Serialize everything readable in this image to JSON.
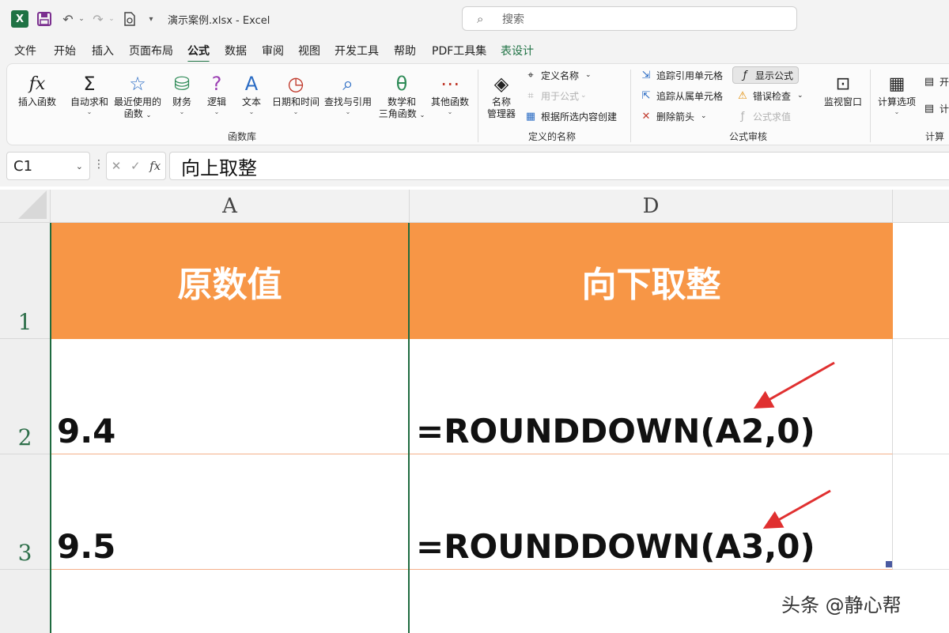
{
  "titlebar": {
    "excel_logo": "X",
    "filename": "演示案例.xlsx",
    "separator": "-",
    "app": "Excel",
    "search_placeholder": "搜索"
  },
  "menu": [
    "文件",
    "开始",
    "插入",
    "页面布局",
    "公式",
    "数据",
    "审阅",
    "视图",
    "开发工具",
    "帮助",
    "PDF工具集",
    "表设计"
  ],
  "menu_active": "公式",
  "ribbon": {
    "function_library": {
      "label": "函数库",
      "buttons": {
        "insert": "插入函数",
        "autosum": "自动求和",
        "recent_line1": "最近使用的",
        "recent_line2": "函数",
        "finance": "财务",
        "logic": "逻辑",
        "text": "文本",
        "datetime": "日期和时间",
        "lookup": "查找与引用",
        "math_line1": "数学和",
        "math_line2": "三角函数",
        "other": "其他函数"
      }
    },
    "defined_names": {
      "label": "定义的名称",
      "manager_line1": "名称",
      "manager_line2": "管理器",
      "define": "定义名称",
      "use": "用于公式",
      "create": "根据所选内容创建"
    },
    "auditing": {
      "label": "公式审核",
      "trace_prec": "追踪引用单元格",
      "trace_dep": "追踪从属单元格",
      "remove_arrows": "删除箭头",
      "show_formulas": "显示公式",
      "error_check": "错误检查",
      "evaluate": "公式求值",
      "watch": "监视窗口"
    },
    "calculation": {
      "label": "计算",
      "options": "计算选项",
      "now_partial": "开",
      "sheet_partial": "计"
    }
  },
  "formula_bar": {
    "name_box": "C1",
    "fx": "fx",
    "content": "向上取整"
  },
  "sheet": {
    "columns": [
      "A",
      "D"
    ],
    "rows": [
      "1",
      "2",
      "3"
    ],
    "header_row": [
      "原数值",
      "向下取整"
    ],
    "data": [
      {
        "value": "9.4",
        "formula": "=ROUNDDOWN(A2,0)"
      },
      {
        "value": "9.5",
        "formula": "=ROUNDDOWN(A3,0)"
      }
    ]
  },
  "colors": {
    "header_fill": "#f79646",
    "excel_green": "#1f7244",
    "arrow_red": "#e03030"
  },
  "watermark": "头条 @静心帮"
}
